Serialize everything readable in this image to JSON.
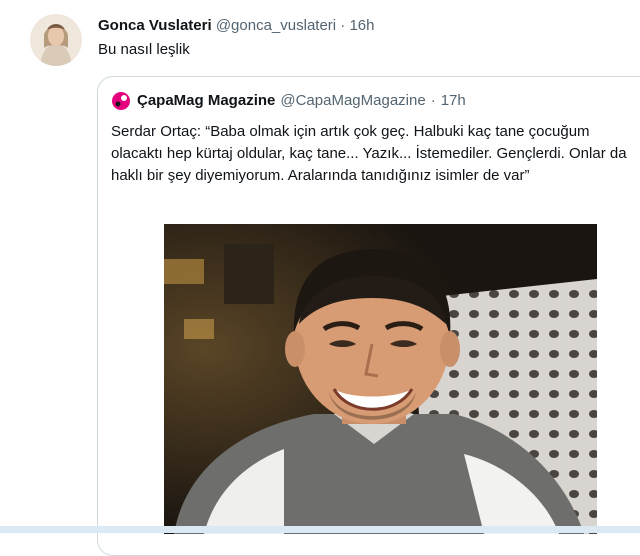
{
  "tweet": {
    "display_name": "Gonca Vuslateri",
    "handle": "@gonca_vuslateri",
    "separator": "·",
    "time": "16h",
    "text": "Bu nasıl leşlik"
  },
  "quoted": {
    "display_name": "ÇapaMag Magazine",
    "handle": "@CapaMagMagazine",
    "separator": "·",
    "time": "17h",
    "text": "Serdar Ortaç: “Baba olmak için artık çok geç. Halbuki kaç tane çocuğum olacaktı hep kürtaj oldular, kaç tane... Yazık... İstemediler. Gençlerdi. Onlar da haklı bir şey diyemiyorum. Aralarında tanıdığınız isimler de var”"
  },
  "colors": {
    "text": "#0f1419",
    "muted": "#536471",
    "border": "#cfd9de",
    "brand_pink": "#e4007c"
  },
  "icons": {
    "author_avatar": "avatar-photo",
    "quoted_avatar": "capamag-logo"
  }
}
